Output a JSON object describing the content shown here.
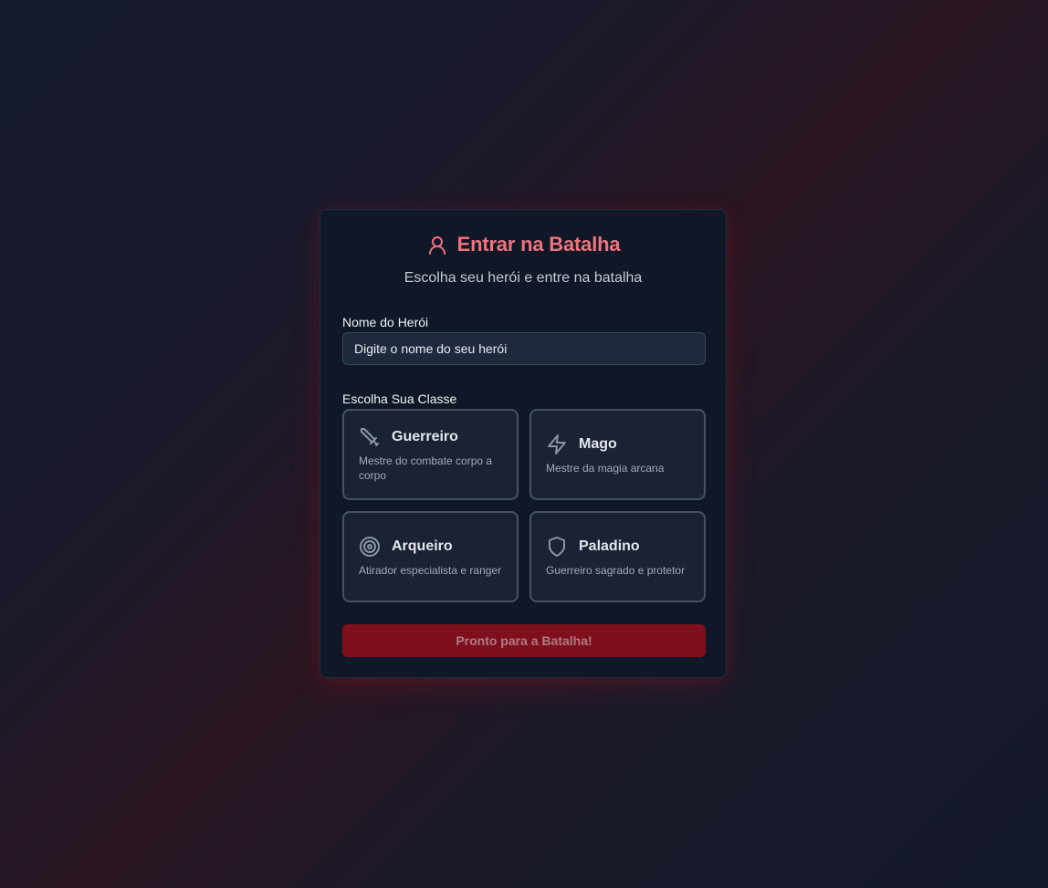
{
  "header": {
    "title": "Entrar na Batalha",
    "subtitle": "Escolha seu herói e entre na batalha",
    "icon": "user-icon"
  },
  "form": {
    "name_label": "Nome do Herói",
    "name_placeholder": "Digite o nome do seu herói",
    "name_value": "",
    "class_label": "Escolha Sua Classe",
    "classes": [
      {
        "name": "Guerreiro",
        "description": "Mestre do combate corpo a corpo",
        "icon": "sword-icon"
      },
      {
        "name": "Mago",
        "description": "Mestre da magia arcana",
        "icon": "zap-icon"
      },
      {
        "name": "Arqueiro",
        "description": "Atirador especialista e ranger",
        "icon": "target-icon"
      },
      {
        "name": "Paladino",
        "description": "Guerreiro sagrado e protetor",
        "icon": "shield-icon"
      }
    ],
    "submit_label": "Pronto para a Batalha!",
    "submit_disabled": true
  },
  "colors": {
    "accent": "#f0727d",
    "button_bg": "#7f0f1c",
    "card_bg": "#101828",
    "option_border": "#465264"
  }
}
